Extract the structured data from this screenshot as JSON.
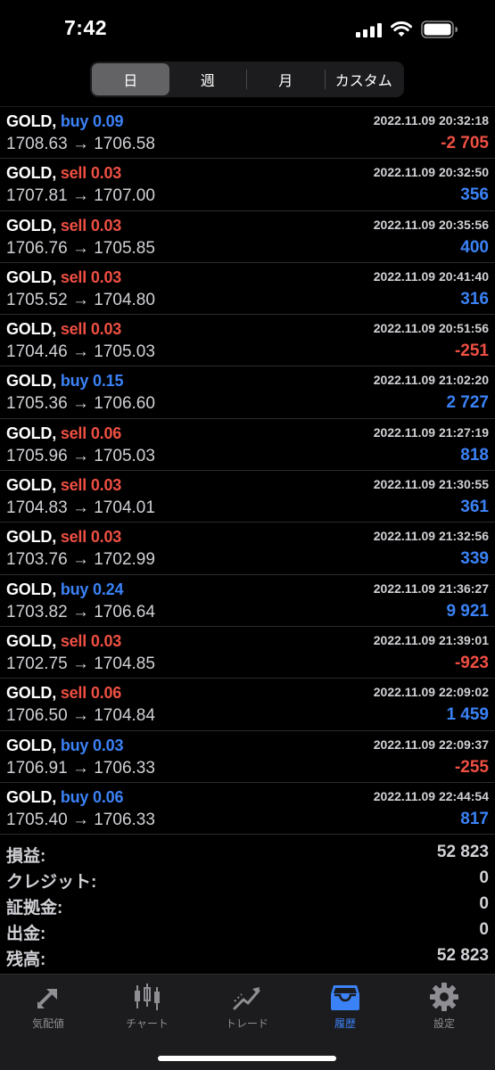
{
  "status_bar": {
    "time": "7:42"
  },
  "segments": [
    {
      "label": "日",
      "active": true
    },
    {
      "label": "週",
      "active": false
    },
    {
      "label": "月",
      "active": false
    },
    {
      "label": "カスタム",
      "active": false
    }
  ],
  "trades": [
    {
      "symbol": "GOLD,",
      "direction": "buy",
      "volume": "0.09",
      "prices": "1708.63 → 1706.58",
      "datetime": "2022.11.09 20:32:18",
      "profit": "-2 705"
    },
    {
      "symbol": "GOLD,",
      "direction": "sell",
      "volume": "0.03",
      "prices": "1707.81 → 1707.00",
      "datetime": "2022.11.09 20:32:50",
      "profit": "356"
    },
    {
      "symbol": "GOLD,",
      "direction": "sell",
      "volume": "0.03",
      "prices": "1706.76 → 1705.85",
      "datetime": "2022.11.09 20:35:56",
      "profit": "400"
    },
    {
      "symbol": "GOLD,",
      "direction": "sell",
      "volume": "0.03",
      "prices": "1705.52 → 1704.80",
      "datetime": "2022.11.09 20:41:40",
      "profit": "316"
    },
    {
      "symbol": "GOLD,",
      "direction": "sell",
      "volume": "0.03",
      "prices": "1704.46 → 1705.03",
      "datetime": "2022.11.09 20:51:56",
      "profit": "-251"
    },
    {
      "symbol": "GOLD,",
      "direction": "buy",
      "volume": "0.15",
      "prices": "1705.36 → 1706.60",
      "datetime": "2022.11.09 21:02:20",
      "profit": "2 727"
    },
    {
      "symbol": "GOLD,",
      "direction": "sell",
      "volume": "0.06",
      "prices": "1705.96 → 1705.03",
      "datetime": "2022.11.09 21:27:19",
      "profit": "818"
    },
    {
      "symbol": "GOLD,",
      "direction": "sell",
      "volume": "0.03",
      "prices": "1704.83 → 1704.01",
      "datetime": "2022.11.09 21:30:55",
      "profit": "361"
    },
    {
      "symbol": "GOLD,",
      "direction": "sell",
      "volume": "0.03",
      "prices": "1703.76 → 1702.99",
      "datetime": "2022.11.09 21:32:56",
      "profit": "339"
    },
    {
      "symbol": "GOLD,",
      "direction": "buy",
      "volume": "0.24",
      "prices": "1703.82 → 1706.64",
      "datetime": "2022.11.09 21:36:27",
      "profit": "9 921"
    },
    {
      "symbol": "GOLD,",
      "direction": "sell",
      "volume": "0.03",
      "prices": "1702.75 → 1704.85",
      "datetime": "2022.11.09 21:39:01",
      "profit": "-923"
    },
    {
      "symbol": "GOLD,",
      "direction": "sell",
      "volume": "0.06",
      "prices": "1706.50 → 1704.84",
      "datetime": "2022.11.09 22:09:02",
      "profit": "1 459"
    },
    {
      "symbol": "GOLD,",
      "direction": "buy",
      "volume": "0.03",
      "prices": "1706.91 → 1706.33",
      "datetime": "2022.11.09 22:09:37",
      "profit": "-255"
    },
    {
      "symbol": "GOLD,",
      "direction": "buy",
      "volume": "0.06",
      "prices": "1705.40 → 1706.33",
      "datetime": "2022.11.09 22:44:54",
      "profit": "817"
    }
  ],
  "summary": [
    {
      "label": "損益:",
      "value": "52 823"
    },
    {
      "label": "クレジット:",
      "value": "0"
    },
    {
      "label": "証拠金:",
      "value": "0"
    },
    {
      "label": "出金:",
      "value": "0"
    },
    {
      "label": "残高:",
      "value": "52 823"
    }
  ],
  "tabs": [
    {
      "label": "気配値",
      "icon": "quotes-icon",
      "active": false
    },
    {
      "label": "チャート",
      "icon": "chart-icon",
      "active": false
    },
    {
      "label": "トレード",
      "icon": "trade-icon",
      "active": false
    },
    {
      "label": "履歴",
      "icon": "history-icon",
      "active": true
    },
    {
      "label": "設定",
      "icon": "settings-icon",
      "active": false
    }
  ],
  "colors": {
    "buy": "#3b82f6",
    "sell": "#ef4f43",
    "profit_positive": "#3b82f6",
    "profit_negative": "#ef4f43",
    "active_tab": "#3b82f6"
  }
}
